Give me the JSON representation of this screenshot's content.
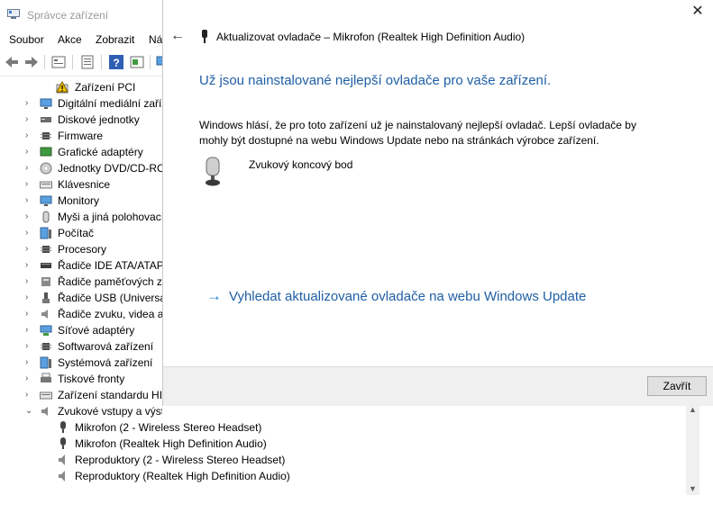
{
  "device_manager": {
    "title": "Správce zařízení",
    "menu": [
      "Soubor",
      "Akce",
      "Zobrazit",
      "Ná"
    ],
    "tree_top": "Zařízení PCI",
    "categories": [
      "Digitální mediální zaříz",
      "Diskové jednotky",
      "Firmware",
      "Grafické adaptéry",
      "Jednotky DVD/CD-ROM",
      "Klávesnice",
      "Monitory",
      "Myši a jiná polohovací",
      "Počítač",
      "Procesory",
      "Řadiče IDE ATA/ATAPI",
      "Řadiče paměťových zař",
      "Řadiče USB (Universal",
      "Řadiče zvuku, videa a h",
      "Síťové adaptéry",
      "Softwarová zařízení",
      "Systémová zařízení",
      "Tiskové fronty",
      "Zařízení standardu HID"
    ],
    "expanded_category": "Zvukové vstupy a výstupy",
    "children": [
      "Mikrofon (2 - Wireless Stereo Headset)",
      "Mikrofon (Realtek High Definition Audio)",
      "Reproduktory (2 - Wireless Stereo Headset)",
      "Reproduktory (Realtek High Definition Audio)"
    ]
  },
  "dialog": {
    "close_glyph": "✕",
    "back_glyph": "←",
    "title": "Aktualizovat ovladače – Mikrofon (Realtek High Definition Audio)",
    "heading": "Už jsou nainstalované nejlepší ovladače pro vaše zařízení.",
    "description": "Windows hlásí, že pro toto zařízení už je nainstalovaný nejlepší ovladač. Lepší ovladače by mohly být dostupné na webu Windows Update nebo na stránkách výrobce zařízení.",
    "device_name": "Zvukový koncový bod",
    "link_arrow": "→",
    "link_text": "Vyhledat aktualizované ovladače na webu Windows Update",
    "close_button": "Zavřít"
  },
  "colors": {
    "heading_blue": "#1f5fa5",
    "link_arrow_blue": "#1f7fd4",
    "footer_gray": "#f0f0f0"
  }
}
